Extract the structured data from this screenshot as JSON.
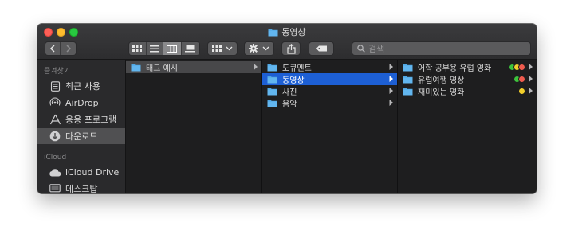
{
  "window": {
    "title": "동영상"
  },
  "colors": {
    "selection_blue": "#1d5fd4",
    "folder_blue": "#4fa6e3",
    "tag_green": "#3dc43d",
    "tag_yellow": "#f2cf2b",
    "tag_red": "#f05b4e"
  },
  "toolbar": {
    "back_icon": "chevron-left-icon",
    "forward_icon": "chevron-right-icon",
    "view_modes": [
      "icon-view-icon",
      "list-view-icon",
      "column-view-icon",
      "gallery-view-icon"
    ],
    "active_view": "column-view-icon",
    "group_icon": "grid-group-icon",
    "action_icon": "gear-icon",
    "share_icon": "share-icon",
    "tag_icon": "tag-icon",
    "search_placeholder": "검색"
  },
  "sidebar": {
    "favorites_header": "즐겨찾기",
    "favorites": [
      {
        "label": "최근 사용",
        "icon": "recents-icon"
      },
      {
        "label": "AirDrop",
        "icon": "airdrop-icon"
      },
      {
        "label": "응용 프로그램",
        "icon": "applications-icon"
      },
      {
        "label": "다운로드",
        "icon": "downloads-icon",
        "active": true
      }
    ],
    "icloud_header": "iCloud",
    "icloud": [
      {
        "label": "iCloud Drive",
        "icon": "cloud-icon"
      },
      {
        "label": "데스크탑",
        "icon": "desktop-icon"
      }
    ]
  },
  "columns": [
    {
      "items": [
        {
          "label": "태그 예시",
          "selected": "inactive"
        }
      ]
    },
    {
      "items": [
        {
          "label": "도큐멘트"
        },
        {
          "label": "동영상",
          "selected": "active"
        },
        {
          "label": "사진"
        },
        {
          "label": "음악"
        }
      ]
    },
    {
      "items": [
        {
          "label": "어학 공부용 유럽 영화",
          "tags": [
            "green",
            "yellow",
            "red"
          ]
        },
        {
          "label": "유럽여행 영상",
          "tags": [
            "green",
            "red"
          ]
        },
        {
          "label": "재미있는 영화",
          "tags": [
            "yellow"
          ]
        }
      ]
    }
  ]
}
